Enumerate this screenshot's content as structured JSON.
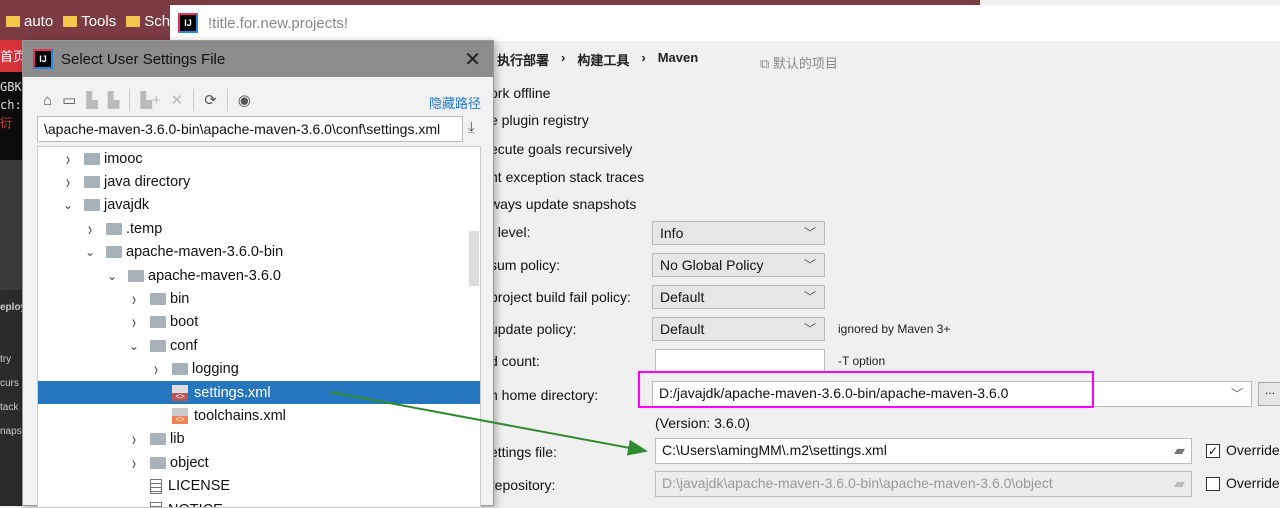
{
  "browser": {
    "bookmarks": [
      "auto",
      "Tools",
      "Sche"
    ],
    "tab_text": "首页",
    "terminal": [
      "GBK",
      "ch:",
      "衍"
    ],
    "side_panel": [
      "eploy",
      "try",
      "curs",
      "tack",
      "naps"
    ]
  },
  "ide": {
    "title": "!title.for.new.projects!",
    "breadcrumb": [
      "执行部署",
      "构建工具",
      "Maven"
    ],
    "default_project": "默认的项目",
    "options": [
      "ork offline",
      "e plugin registry",
      "ecute goals recursively",
      "nt exception stack traces",
      "ways update snapshots"
    ],
    "fields": {
      "output_level": {
        "label": "t level:",
        "value": "Info"
      },
      "checksum": {
        "label": "sum policy:",
        "value": "No Global Policy"
      },
      "fail": {
        "label": "project build fail policy:",
        "value": "Default"
      },
      "update": {
        "label": "update policy:",
        "value": "Default",
        "note": "ignored by Maven 3+"
      },
      "threads": {
        "label": "d count:",
        "value": "",
        "note": "-T option"
      },
      "home": {
        "label": "n home directory:",
        "value": "D:/javajdk/apache-maven-3.6.0-bin/apache-maven-3.6.0",
        "version": "(Version: 3.6.0)",
        "browse": "..."
      },
      "settings": {
        "label": "ettings file:",
        "value": "C:\\Users\\amingMM\\.m2\\settings.xml",
        "override": "Override",
        "checked": true
      },
      "repo": {
        "label": "repository:",
        "value": "D:\\javajdk\\apache-maven-3.6.0-bin\\apache-maven-3.6.0\\object",
        "override": "Override",
        "checked": false
      }
    }
  },
  "dialog": {
    "title": "Select User Settings File",
    "hide_path": "隐藏路径",
    "path": "\\apache-maven-3.6.0-bin\\apache-maven-3.6.0\\conf\\settings.xml",
    "tree": [
      {
        "label": "imooc",
        "depth": 0,
        "type": "folder",
        "arrow": "›"
      },
      {
        "label": "java directory",
        "depth": 0,
        "type": "folder",
        "arrow": "›"
      },
      {
        "label": "javajdk",
        "depth": 0,
        "type": "folder",
        "arrow": "⌄"
      },
      {
        "label": ".temp",
        "depth": 1,
        "type": "folder",
        "arrow": "›"
      },
      {
        "label": "apache-maven-3.6.0-bin",
        "depth": 1,
        "type": "folder",
        "arrow": "⌄"
      },
      {
        "label": "apache-maven-3.6.0",
        "depth": 2,
        "type": "folder",
        "arrow": "⌄"
      },
      {
        "label": "bin",
        "depth": 3,
        "type": "folder",
        "arrow": "›"
      },
      {
        "label": "boot",
        "depth": 3,
        "type": "folder",
        "arrow": "›"
      },
      {
        "label": "conf",
        "depth": 3,
        "type": "folder",
        "arrow": "⌄"
      },
      {
        "label": "logging",
        "depth": 4,
        "type": "folder",
        "arrow": "›"
      },
      {
        "label": "settings.xml",
        "depth": 4,
        "type": "xml",
        "arrow": "",
        "selected": true
      },
      {
        "label": "toolchains.xml",
        "depth": 4,
        "type": "xml",
        "arrow": ""
      },
      {
        "label": "lib",
        "depth": 3,
        "type": "folder",
        "arrow": "›"
      },
      {
        "label": "object",
        "depth": 3,
        "type": "folder",
        "arrow": "›"
      },
      {
        "label": "LICENSE",
        "depth": 3,
        "type": "text",
        "arrow": ""
      },
      {
        "label": "NOTICE",
        "depth": 3,
        "type": "text",
        "arrow": ""
      }
    ]
  }
}
